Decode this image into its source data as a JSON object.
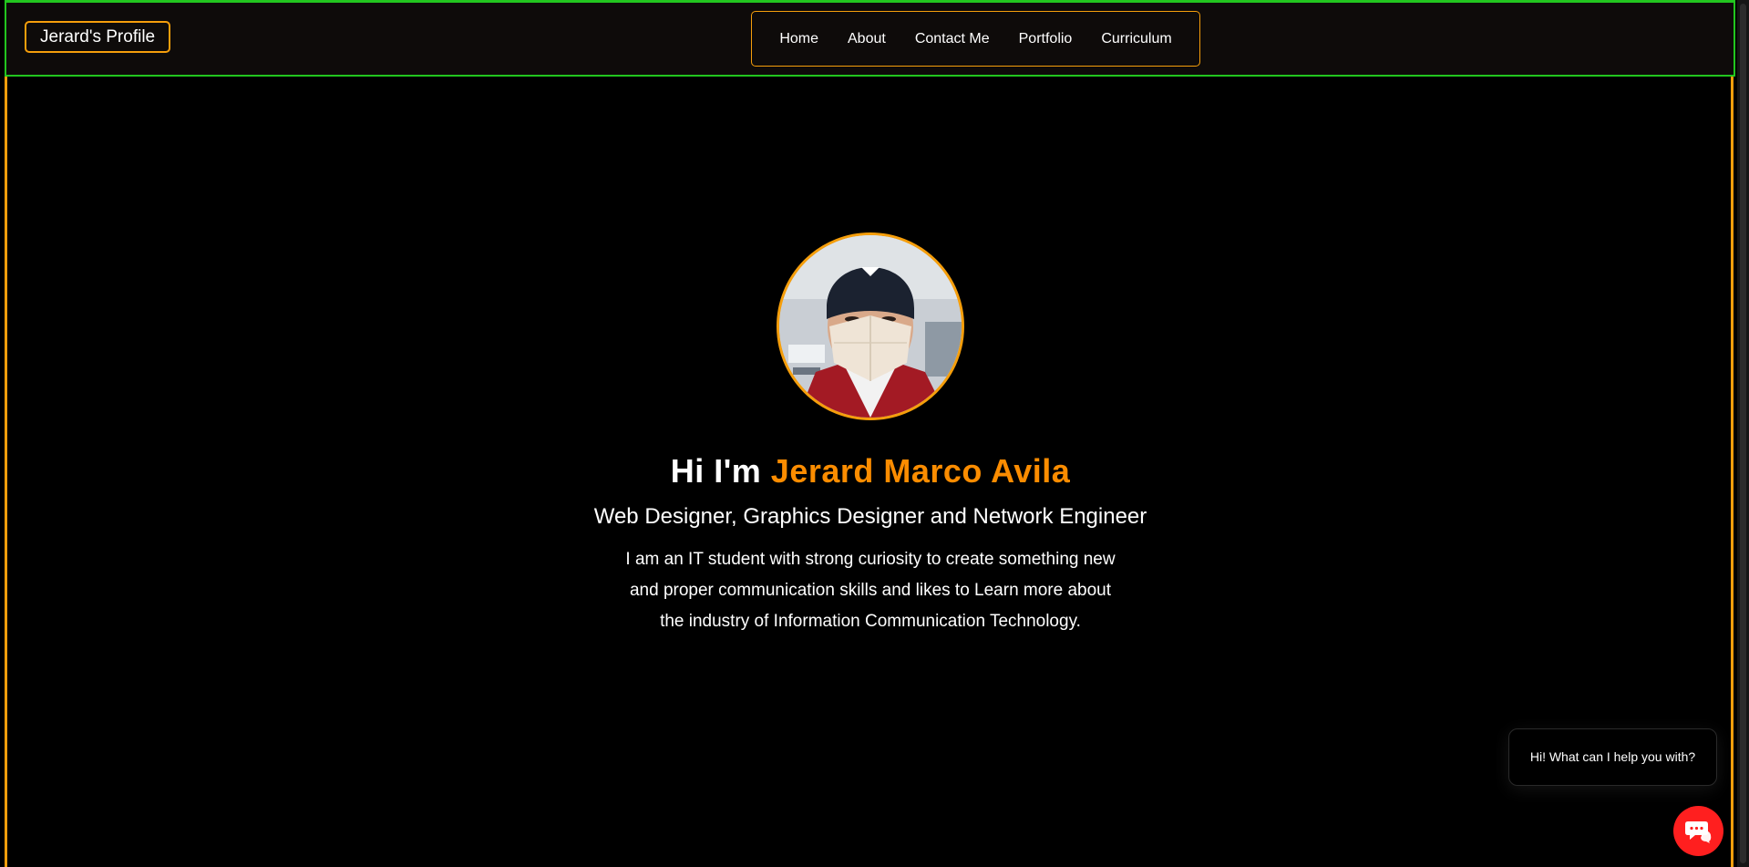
{
  "navbar": {
    "brand": "Jerard's Profile",
    "links": [
      "Home",
      "About",
      "Contact Me",
      "Portfolio",
      "Curriculum"
    ]
  },
  "hero": {
    "greeting_prefix": "Hi I'm",
    "name": "Jerard Marco Avila",
    "subtitle": "Web Designer, Graphics Designer and Network Engineer",
    "bio_lines": [
      "I am an IT student with strong curiosity to create something new",
      "and proper communication skills and likes to Learn more about",
      "the industry of Information Communication Technology."
    ]
  },
  "chat": {
    "prompt": "Hi! What can I help you with?",
    "button_icon": "chat-icon"
  },
  "colors": {
    "accent": "#f59e0b",
    "name_orange": "#fb8c00",
    "nav_border_green": "#22c51f",
    "chat_red": "#ff1f1f",
    "background": "#000000"
  }
}
